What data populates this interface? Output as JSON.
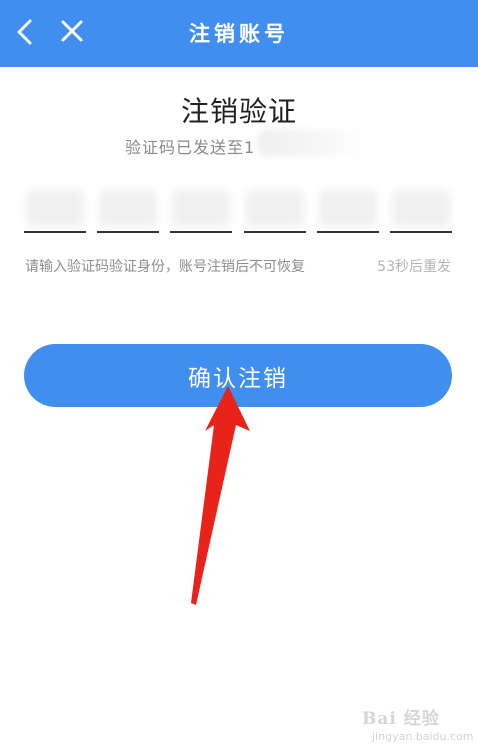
{
  "header": {
    "title": "注销账号",
    "back_icon": "chevron-left-icon",
    "close_icon": "close-icon",
    "background_color": "#3f8ef0"
  },
  "verification": {
    "title": "注销验证",
    "sent_text": "验证码已发送至1",
    "code_digit_count": 6,
    "hint": "请输入验证码验证身份，账号注销后不可恢复",
    "resend_text": "53秒后重发"
  },
  "confirm_button": {
    "label": "确认注销",
    "color": "#3f8ef0"
  },
  "annotation": {
    "icon": "red-arrow-icon",
    "color": "#e8231a"
  },
  "watermark": {
    "logo": "Bai 经验",
    "url": "jingyan.baidu.com"
  }
}
